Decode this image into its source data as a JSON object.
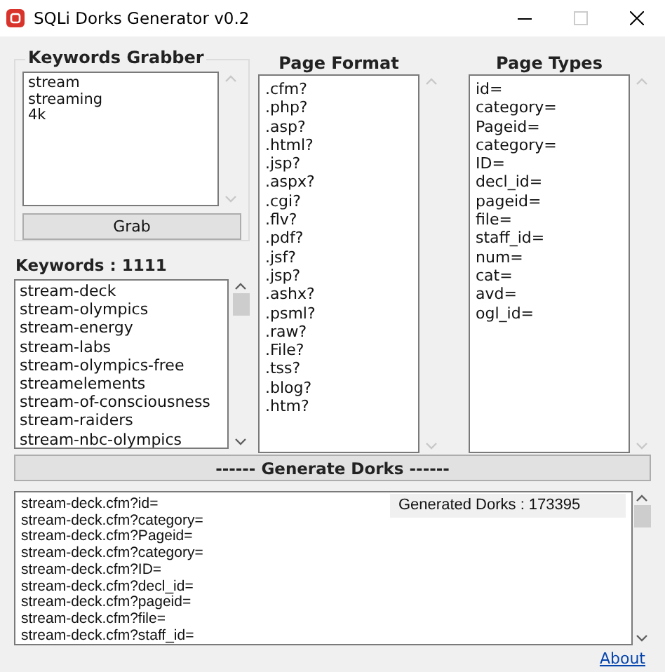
{
  "window": {
    "title": "SQLi Dorks Generator v0.2"
  },
  "keywords_grabber": {
    "title": "Keywords Grabber",
    "input_lines": [
      "stream",
      "streaming",
      "4k"
    ],
    "button": "Grab"
  },
  "keywords": {
    "label": "Keywords : 1111",
    "items": [
      "stream-deck",
      "stream-olympics",
      "stream-energy",
      "stream-labs",
      "stream-olympics-free",
      "streamelements",
      "stream-of-consciousness",
      "stream-raiders",
      "stream-nbc-olympics"
    ]
  },
  "page_format": {
    "title": "Page Format",
    "items": [
      ".cfm?",
      ".php?",
      ".asp?",
      ".html?",
      ".jsp?",
      ".aspx?",
      ".cgi?",
      ".flv?",
      ".pdf?",
      ".jsf?",
      ".jsp?",
      ".ashx?",
      ".psml?",
      ".raw?",
      ".File?",
      ".tss?",
      ".blog?",
      ".htm?"
    ]
  },
  "page_types": {
    "title": "Page Types",
    "items": [
      "id=",
      "category=",
      "Pageid=",
      "category=",
      "ID=",
      "decl_id=",
      "pageid=",
      "file=",
      "staff_id=",
      "num=",
      "cat=",
      "avd=",
      "ogl_id="
    ]
  },
  "generate_button": "------ Generate Dorks ------",
  "output": {
    "lines": [
      "stream-deck.cfm?id=",
      "stream-deck.cfm?category=",
      "stream-deck.cfm?Pageid=",
      "stream-deck.cfm?category=",
      "stream-deck.cfm?ID=",
      "stream-deck.cfm?decl_id=",
      "stream-deck.cfm?pageid=",
      "stream-deck.cfm?file=",
      "stream-deck.cfm?staff_id="
    ],
    "count_label": "Generated Dorks : 173395"
  },
  "about_link": "About"
}
